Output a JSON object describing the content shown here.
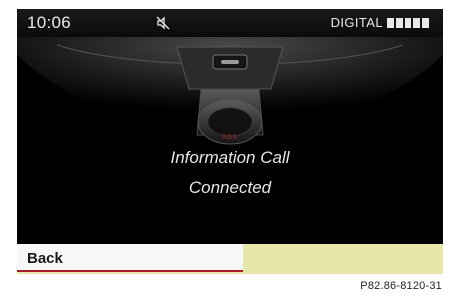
{
  "status_bar": {
    "time": "10:06",
    "mute_icon": "speaker-muted-icon",
    "source": "DIGITAL",
    "signal_icon": "signal-strength-bars-icon",
    "signal_level": 5
  },
  "call_screen": {
    "sos_label": "SOS",
    "line1": "Information Call",
    "line2": "Connected"
  },
  "softkeys": {
    "back_label": "Back",
    "right_label": ""
  },
  "figure_code": "P82.86-8120-31",
  "colors": {
    "accent_red": "#a9202a",
    "softkey_yellow": "#e7e7a9",
    "screen_bg": "#000000"
  }
}
